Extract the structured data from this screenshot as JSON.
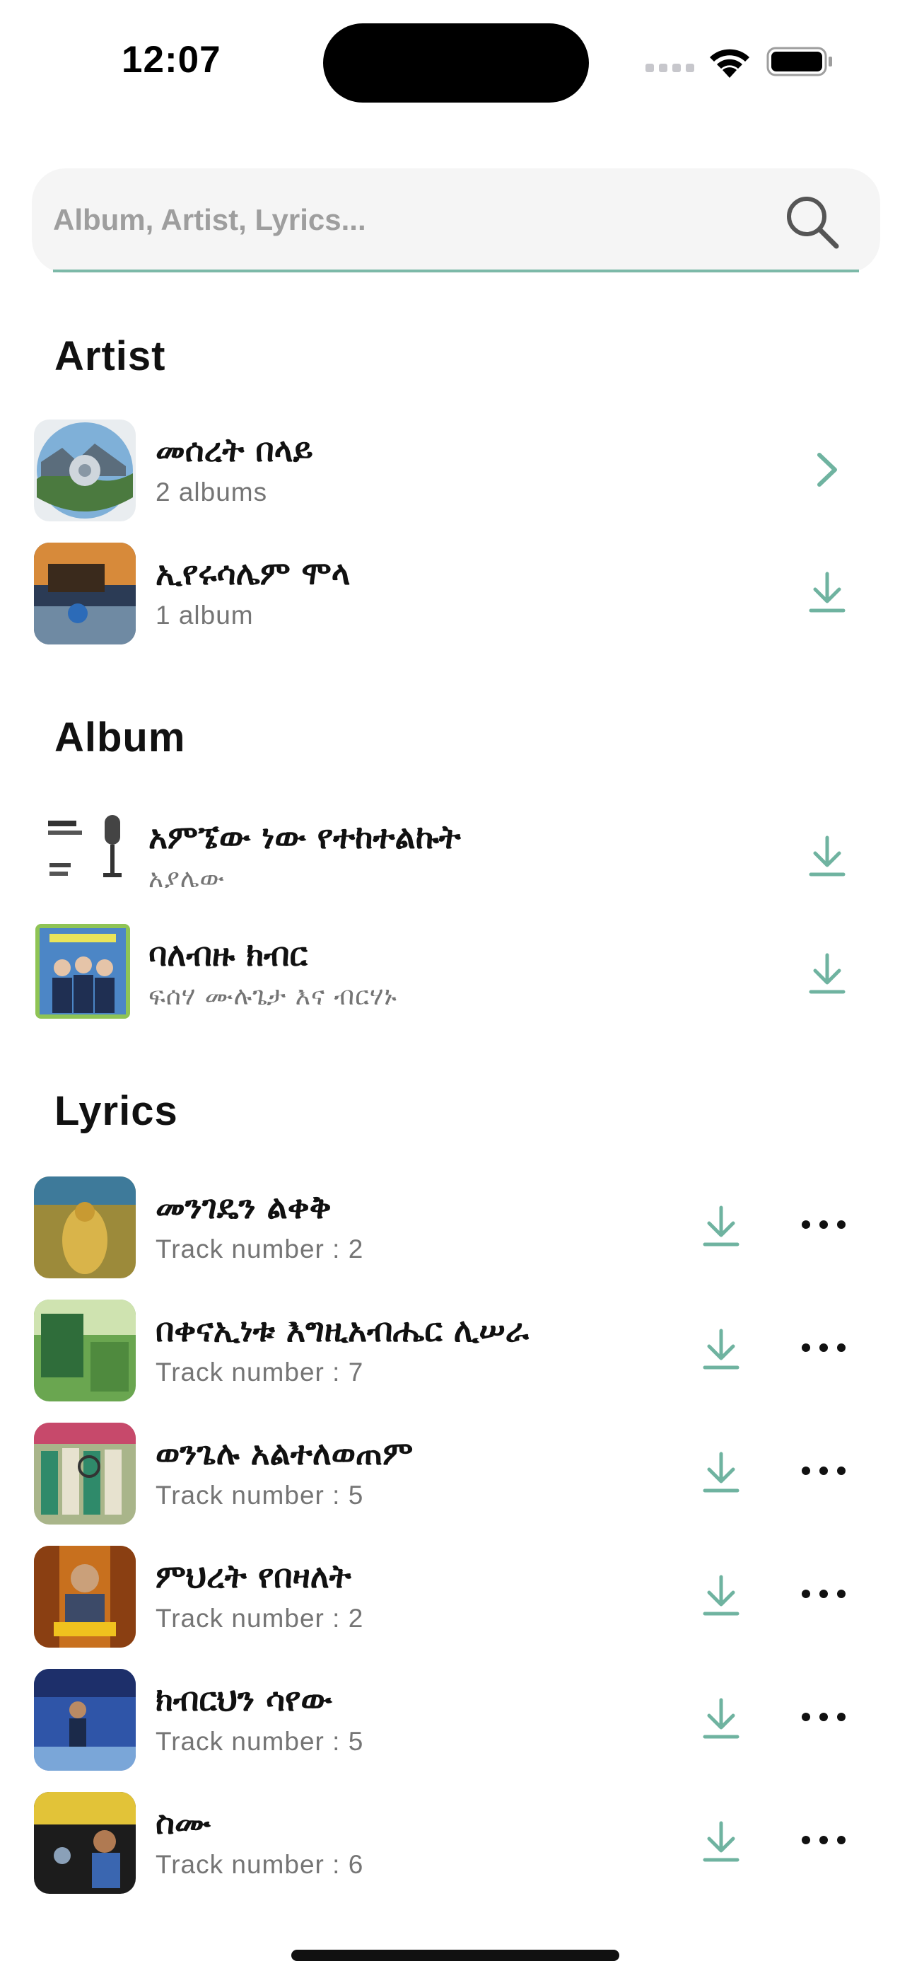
{
  "status_bar": {
    "time": "12:07"
  },
  "search": {
    "placeholder": "Album, Artist, Lyrics...",
    "value": ""
  },
  "colors": {
    "accent": "#6fb3a0",
    "text": "#111111",
    "muted": "#757575"
  },
  "sections": {
    "artist": {
      "title": "Artist",
      "items": [
        {
          "name": "መሰረት በላይ",
          "sub": "2 albums",
          "action_icon": "chevron-right-icon"
        },
        {
          "name": "ኢየሩሳሌም ሞላ",
          "sub": "1 album",
          "action_icon": "download-icon"
        }
      ]
    },
    "album": {
      "title": "Album",
      "items": [
        {
          "name": "አምኜው ነው የተከተልኩት",
          "sub": "አያሌው",
          "action_icon": "download-icon"
        },
        {
          "name": "ባለብዙ ክብር",
          "sub": "ፍሰሃ ሙሉጌታ እና ብርሃኑ",
          "action_icon": "download-icon"
        }
      ]
    },
    "lyrics": {
      "title": "Lyrics",
      "items": [
        {
          "name": "መንገዴን ልቀቅ",
          "sub": "Track number : 2",
          "action_icon": "download-icon",
          "more_icon": "more-horizontal-icon"
        },
        {
          "name": "በቀናኢነቱ እግዚአብሔር ሊሠራ",
          "sub": "Track number : 7",
          "action_icon": "download-icon",
          "more_icon": "more-horizontal-icon"
        },
        {
          "name": "ወንጌሉ አልተለወጠም",
          "sub": "Track number : 5",
          "action_icon": "download-icon",
          "more_icon": "more-horizontal-icon"
        },
        {
          "name": "ምህረት የበዛለት",
          "sub": "Track number : 2",
          "action_icon": "download-icon",
          "more_icon": "more-horizontal-icon"
        },
        {
          "name": "ክብርህን ሳየው",
          "sub": "Track number : 5",
          "action_icon": "download-icon",
          "more_icon": "more-horizontal-icon"
        },
        {
          "name": "ስሙ",
          "sub": "Track number : 6",
          "action_icon": "download-icon",
          "more_icon": "more-horizontal-icon"
        }
      ]
    }
  }
}
